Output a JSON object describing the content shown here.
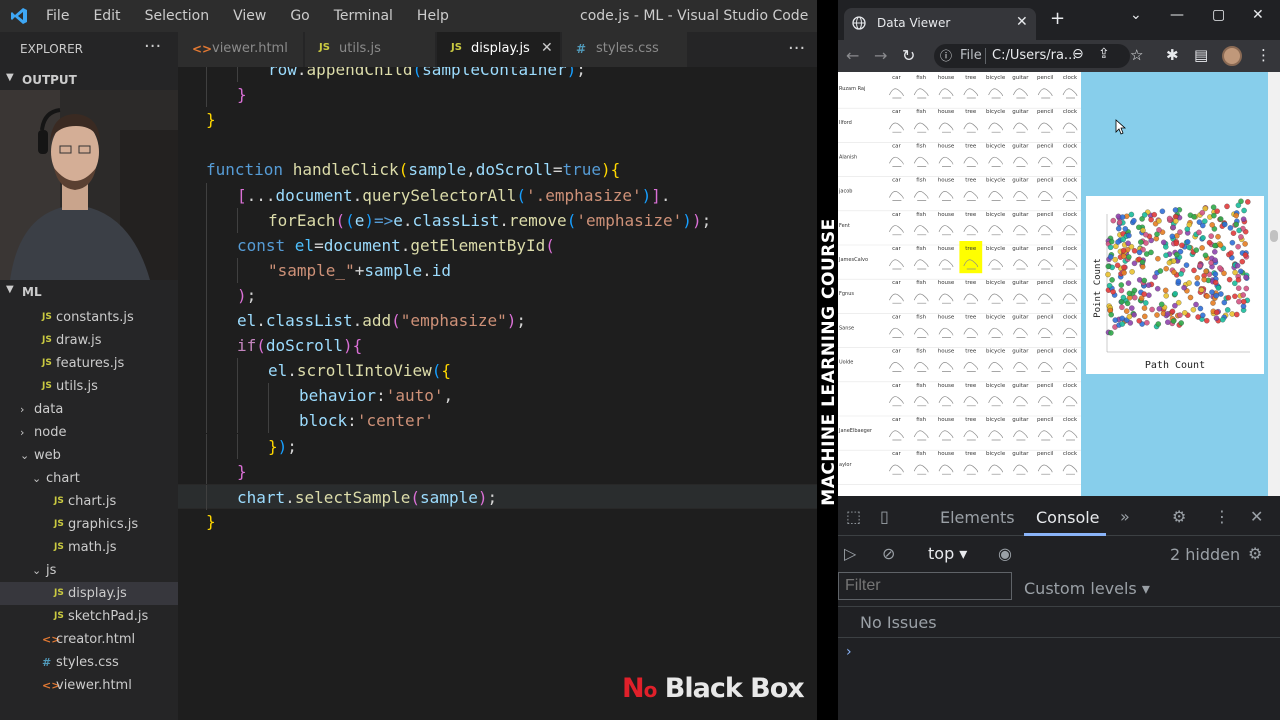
{
  "vscode": {
    "menu": [
      "File",
      "Edit",
      "Selection",
      "View",
      "Go",
      "Terminal",
      "Help"
    ],
    "window_title": "code.js - ML - Visual Studio Code",
    "explorer": {
      "title": "EXPLORER",
      "more": "···",
      "output_section": "OUTPUT",
      "ml_section": "ML",
      "tree": [
        {
          "label": "constants.js",
          "type": "js",
          "depth": 1
        },
        {
          "label": "draw.js",
          "type": "js",
          "depth": 1
        },
        {
          "label": "features.js",
          "type": "js",
          "depth": 1
        },
        {
          "label": "utils.js",
          "type": "js",
          "depth": 1
        },
        {
          "label": "data",
          "type": "folder",
          "depth": 0,
          "open": false
        },
        {
          "label": "node",
          "type": "folder",
          "depth": 0,
          "open": false
        },
        {
          "label": "web",
          "type": "folder",
          "depth": 0,
          "open": true
        },
        {
          "label": "chart",
          "type": "folder",
          "depth": 1,
          "open": true
        },
        {
          "label": "chart.js",
          "type": "js",
          "depth": 2
        },
        {
          "label": "graphics.js",
          "type": "js",
          "depth": 2
        },
        {
          "label": "math.js",
          "type": "js",
          "depth": 2
        },
        {
          "label": "js",
          "type": "folder",
          "depth": 1,
          "open": true
        },
        {
          "label": "display.js",
          "type": "js",
          "depth": 2,
          "selected": true
        },
        {
          "label": "sketchPad.js",
          "type": "js",
          "depth": 2
        },
        {
          "label": "creator.html",
          "type": "html",
          "depth": 1
        },
        {
          "label": "styles.css",
          "type": "css",
          "depth": 1
        },
        {
          "label": "viewer.html",
          "type": "html",
          "depth": 1
        }
      ]
    },
    "tabs": [
      {
        "label": "viewer.html",
        "type": "html",
        "active": false
      },
      {
        "label": "utils.js",
        "type": "js",
        "active": false
      },
      {
        "label": "display.js",
        "type": "js",
        "active": true
      },
      {
        "label": "styles.css",
        "type": "css",
        "active": false
      }
    ],
    "tabs_more": "···",
    "code_lines": [
      {
        "indent": 2,
        "cursor": false,
        "tokens": [
          [
            "vr",
            "row"
          ],
          [
            "d",
            "."
          ],
          [
            "fn",
            "appendChild"
          ],
          [
            "p3",
            "("
          ],
          [
            "vr",
            "sampleContainer"
          ],
          [
            "p3",
            ")"
          ],
          [
            "d",
            ";"
          ]
        ]
      },
      {
        "indent": 1,
        "cursor": false,
        "tokens": [
          [
            "p2",
            "}"
          ]
        ]
      },
      {
        "indent": 0,
        "cursor": false,
        "tokens": [
          [
            "p1",
            "}"
          ]
        ]
      },
      {
        "indent": 0,
        "cursor": false,
        "tokens": []
      },
      {
        "indent": 0,
        "cursor": false,
        "tokens": [
          [
            "kw",
            "function "
          ],
          [
            "fn",
            "handleClick"
          ],
          [
            "p1",
            "("
          ],
          [
            "vr",
            "sample"
          ],
          [
            "d",
            ","
          ],
          [
            "vr",
            "doScroll"
          ],
          [
            "d",
            "="
          ],
          [
            "kw",
            "true"
          ],
          [
            "p1",
            ")"
          ],
          [
            "p1",
            "{"
          ]
        ]
      },
      {
        "indent": 1,
        "cursor": false,
        "tokens": [
          [
            "p2",
            "["
          ],
          [
            "d",
            "..."
          ],
          [
            "vr",
            "document"
          ],
          [
            "d",
            "."
          ],
          [
            "fn",
            "querySelectorAll"
          ],
          [
            "p3",
            "("
          ],
          [
            "st",
            "'.emphasize'"
          ],
          [
            "p3",
            ")"
          ],
          [
            "p2",
            "]"
          ],
          [
            "d",
            "."
          ]
        ]
      },
      {
        "indent": 2,
        "cursor": false,
        "tokens": [
          [
            "fn",
            "forEach"
          ],
          [
            "p2",
            "("
          ],
          [
            "p3",
            "("
          ],
          [
            "vr",
            "e"
          ],
          [
            "p3",
            ")"
          ],
          [
            "kw",
            "=>"
          ],
          [
            "vr",
            "e"
          ],
          [
            "d",
            "."
          ],
          [
            "vr",
            "classList"
          ],
          [
            "d",
            "."
          ],
          [
            "fn",
            "remove"
          ],
          [
            "p3",
            "("
          ],
          [
            "st",
            "'emphasize'"
          ],
          [
            "p3",
            ")"
          ],
          [
            "p2",
            ")"
          ],
          [
            "d",
            ";"
          ]
        ]
      },
      {
        "indent": 1,
        "cursor": false,
        "tokens": [
          [
            "kw",
            "const "
          ],
          [
            "cn",
            "el"
          ],
          [
            "d",
            "="
          ],
          [
            "vr",
            "document"
          ],
          [
            "d",
            "."
          ],
          [
            "fn",
            "getElementById"
          ],
          [
            "p2",
            "("
          ]
        ]
      },
      {
        "indent": 2,
        "cursor": false,
        "tokens": [
          [
            "st",
            "\"sample_\""
          ],
          [
            "d",
            "+"
          ],
          [
            "vr",
            "sample"
          ],
          [
            "d",
            "."
          ],
          [
            "vr",
            "id"
          ]
        ]
      },
      {
        "indent": 1,
        "cursor": false,
        "tokens": [
          [
            "p2",
            ")"
          ],
          [
            "d",
            ";"
          ]
        ]
      },
      {
        "indent": 1,
        "cursor": false,
        "tokens": [
          [
            "vr",
            "el"
          ],
          [
            "d",
            "."
          ],
          [
            "vr",
            "classList"
          ],
          [
            "d",
            "."
          ],
          [
            "fn",
            "add"
          ],
          [
            "p2",
            "("
          ],
          [
            "st",
            "\"emphasize\""
          ],
          [
            "p2",
            ")"
          ],
          [
            "d",
            ";"
          ]
        ]
      },
      {
        "indent": 1,
        "cursor": false,
        "tokens": [
          [
            "kc",
            "if"
          ],
          [
            "p2",
            "("
          ],
          [
            "vr",
            "doScroll"
          ],
          [
            "p2",
            ")"
          ],
          [
            "p2",
            "{"
          ]
        ]
      },
      {
        "indent": 2,
        "cursor": false,
        "tokens": [
          [
            "vr",
            "el"
          ],
          [
            "d",
            "."
          ],
          [
            "fn",
            "scrollIntoView"
          ],
          [
            "p3",
            "("
          ],
          [
            "p1",
            "{"
          ]
        ]
      },
      {
        "indent": 3,
        "cursor": false,
        "tokens": [
          [
            "vr",
            "behavior"
          ],
          [
            "d",
            ":"
          ],
          [
            "st",
            "'auto'"
          ],
          [
            "d",
            ","
          ]
        ]
      },
      {
        "indent": 3,
        "cursor": false,
        "tokens": [
          [
            "vr",
            "block"
          ],
          [
            "d",
            ":"
          ],
          [
            "st",
            "'center'"
          ]
        ]
      },
      {
        "indent": 2,
        "cursor": false,
        "tokens": [
          [
            "p1",
            "}"
          ],
          [
            "p3",
            ")"
          ],
          [
            "d",
            ";"
          ]
        ]
      },
      {
        "indent": 1,
        "cursor": false,
        "tokens": [
          [
            "p2",
            "}"
          ]
        ]
      },
      {
        "indent": 1,
        "cursor": true,
        "tokens": [
          [
            "vr",
            "chart"
          ],
          [
            "d",
            "."
          ],
          [
            "fn",
            "selectSample"
          ],
          [
            "p2",
            "("
          ],
          [
            "vr",
            "sample"
          ],
          [
            "p2",
            ")"
          ],
          [
            "d",
            ";"
          ]
        ]
      },
      {
        "indent": 0,
        "cursor": false,
        "tokens": [
          [
            "p1",
            "}"
          ]
        ]
      }
    ],
    "brand": {
      "n": "N",
      "o": "o",
      "rest": " Black Box"
    }
  },
  "side_banner": "MACHINE LEARNING COURSE",
  "chrome": {
    "tab_title": "Data Viewer",
    "new_tab": "+",
    "file_label": "File",
    "url": "C:/Users/ra...",
    "page": {
      "labels": [
        "car",
        "fish",
        "house",
        "tree",
        "bicycle",
        "guitar",
        "pencil",
        "clock"
      ],
      "row_names": [
        "Ruzam Raj",
        "Ilford",
        "Alanish",
        "jacob",
        "Fent",
        "JamesCalvo",
        "Fgnus",
        "Sanse",
        "Uolde",
        "",
        "JaneElbaeger",
        "aylor"
      ],
      "highlight_row": 5,
      "highlight_col": 3,
      "chart": {
        "ylabel": "Point Count",
        "xlabel": "Path Count"
      },
      "accent": "#87ceeb",
      "highlight_color": "#ffff00"
    },
    "devtools": {
      "tabs": [
        "Elements",
        "Console"
      ],
      "active_tab": "Console",
      "context": "top",
      "hidden": "2 hidden",
      "filter_placeholder": "Filter",
      "levels": "Custom levels",
      "no_issues": "No Issues",
      "prompt": "›"
    }
  }
}
